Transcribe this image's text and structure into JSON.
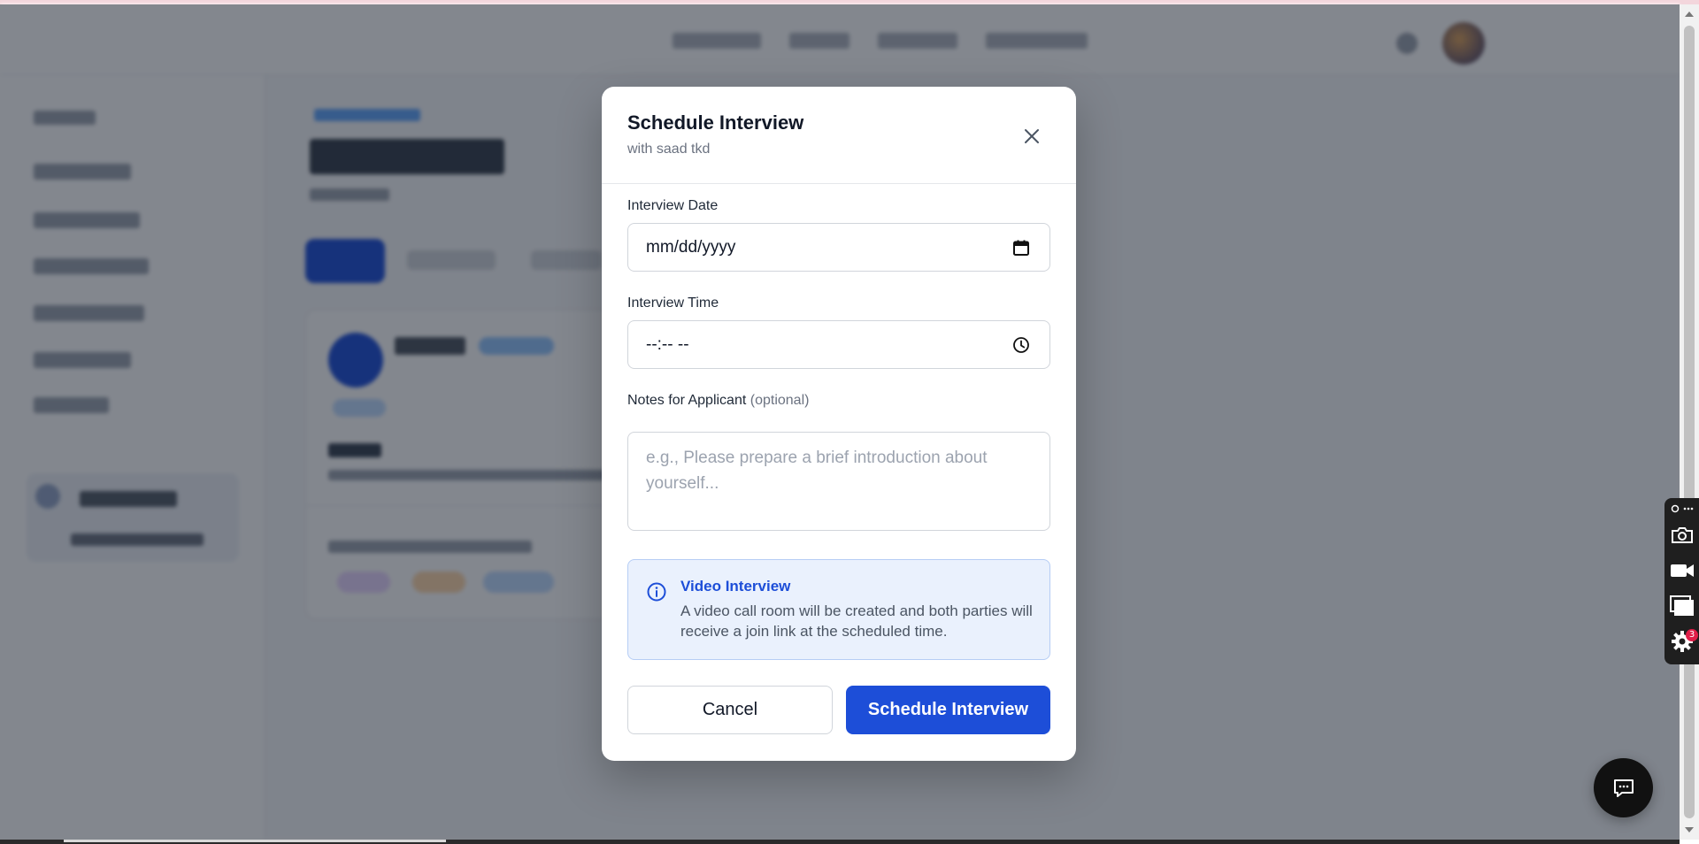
{
  "modal": {
    "title": "Schedule Interview",
    "subtitle": "with saad tkd",
    "fields": {
      "date": {
        "label": "Interview Date",
        "value": "mm/dd/yyyy"
      },
      "time": {
        "label": "Interview Time",
        "value": "--:-- --"
      },
      "notes": {
        "label": "Notes for Applicant",
        "optional": "(optional)",
        "placeholder": "e.g., Please prepare a brief introduction about yourself..."
      }
    },
    "info": {
      "title": "Video Interview",
      "text": "A video call room will be created and both parties will receive a join link at the scheduled time."
    },
    "buttons": {
      "cancel": "Cancel",
      "submit": "Schedule Interview"
    }
  },
  "toolbar": {
    "settings_badge": "3"
  },
  "colors": {
    "accent": "#1d4ed8",
    "info_bg": "#eaf1fd",
    "overlay": "#111827"
  },
  "icons": [
    "close-icon",
    "calendar-icon",
    "clock-icon",
    "info-icon",
    "camera-icon",
    "video-icon",
    "window-icon",
    "gear-icon",
    "chat-icon"
  ]
}
